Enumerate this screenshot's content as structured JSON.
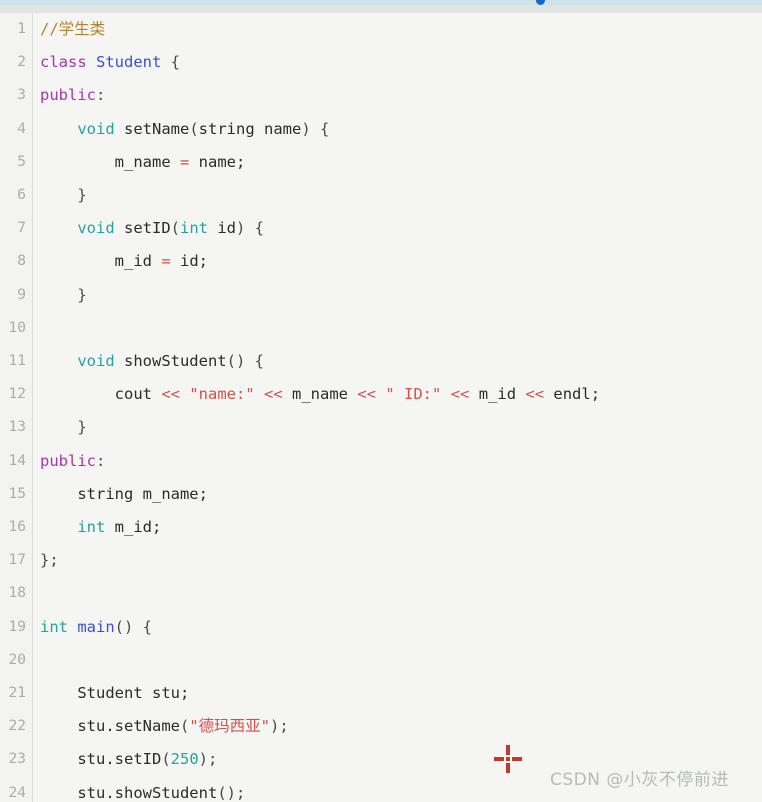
{
  "window": {
    "top_strip_color": "#cfe3ea",
    "header_band_color": "#e2e4e2",
    "accent_dot_color": "#1668c8",
    "editor_background": "#f5f6f4",
    "gutter_background": "#f3f4f2",
    "gutter_divider_color": "#dcdedc"
  },
  "palette": {
    "plain": "#2b2b2b",
    "comment": "#b5822e",
    "keyword": "#a535ae",
    "type": "#25a1a1",
    "class_name": "#3b4ddb",
    "function_name": "#3b4ddb",
    "string": "#d4504a",
    "operator": "#d4504a",
    "number": "#25a1a1",
    "line_number": "#a9acab"
  },
  "editor": {
    "language": "C++",
    "first_visible_line": 1,
    "last_visible_line": 24,
    "gutter_numbers": [
      "1",
      "2",
      "3",
      "4",
      "5",
      "6",
      "7",
      "8",
      "9",
      "10",
      "11",
      "12",
      "13",
      "14",
      "15",
      "16",
      "17",
      "18",
      "19",
      "20",
      "21",
      "22",
      "23",
      "24"
    ],
    "lines": [
      {
        "number": "1",
        "text": "//学生类"
      },
      {
        "number": "2",
        "text": "class Student {"
      },
      {
        "number": "3",
        "text": "public:"
      },
      {
        "number": "4",
        "text": "    void setName(string name) {"
      },
      {
        "number": "5",
        "text": "        m_name = name;"
      },
      {
        "number": "6",
        "text": "    }"
      },
      {
        "number": "7",
        "text": "    void setID(int id) {"
      },
      {
        "number": "8",
        "text": "        m_id = id;"
      },
      {
        "number": "9",
        "text": "    }"
      },
      {
        "number": "10",
        "text": ""
      },
      {
        "number": "11",
        "text": "    void showStudent() {"
      },
      {
        "number": "12",
        "text": "        cout << \"name:\" << m_name << \" ID:\" << m_id << endl;"
      },
      {
        "number": "13",
        "text": "    }"
      },
      {
        "number": "14",
        "text": "public:"
      },
      {
        "number": "15",
        "text": "    string m_name;"
      },
      {
        "number": "16",
        "text": "    int m_id;"
      },
      {
        "number": "17",
        "text": "};"
      },
      {
        "number": "18",
        "text": ""
      },
      {
        "number": "19",
        "text": "int main() {"
      },
      {
        "number": "20",
        "text": ""
      },
      {
        "number": "21",
        "text": "    Student stu;"
      },
      {
        "number": "22",
        "text": "    stu.setName(\"德玛西亚\");"
      },
      {
        "number": "23",
        "text": "    stu.setID(250);"
      },
      {
        "number": "24",
        "text": "    stu.showStudent();"
      }
    ],
    "tokens": [
      [
        {
          "t": "//学生类",
          "c": "comment"
        }
      ],
      [
        {
          "t": "class",
          "c": "keyword"
        },
        {
          "t": " ",
          "c": "plain"
        },
        {
          "t": "Student",
          "c": "class"
        },
        {
          "t": " {",
          "c": "punct"
        }
      ],
      [
        {
          "t": "public",
          "c": "keyword"
        },
        {
          "t": ":",
          "c": "punct"
        }
      ],
      [
        {
          "t": "    ",
          "c": "plain"
        },
        {
          "t": "void",
          "c": "type"
        },
        {
          "t": " setName",
          "c": "plain"
        },
        {
          "t": "(",
          "c": "punct"
        },
        {
          "t": "string",
          "c": "plain"
        },
        {
          "t": " name",
          "c": "plain"
        },
        {
          "t": ") {",
          "c": "punct"
        }
      ],
      [
        {
          "t": "        m_name ",
          "c": "plain"
        },
        {
          "t": "=",
          "c": "op"
        },
        {
          "t": " name;",
          "c": "plain"
        }
      ],
      [
        {
          "t": "    }",
          "c": "punct"
        }
      ],
      [
        {
          "t": "    ",
          "c": "plain"
        },
        {
          "t": "void",
          "c": "type"
        },
        {
          "t": " setID",
          "c": "plain"
        },
        {
          "t": "(",
          "c": "punct"
        },
        {
          "t": "int",
          "c": "type"
        },
        {
          "t": " id",
          "c": "plain"
        },
        {
          "t": ") {",
          "c": "punct"
        }
      ],
      [
        {
          "t": "        m_id ",
          "c": "plain"
        },
        {
          "t": "=",
          "c": "op"
        },
        {
          "t": " id;",
          "c": "plain"
        }
      ],
      [
        {
          "t": "    }",
          "c": "punct"
        }
      ],
      [],
      [
        {
          "t": "    ",
          "c": "plain"
        },
        {
          "t": "void",
          "c": "type"
        },
        {
          "t": " showStudent",
          "c": "plain"
        },
        {
          "t": "() {",
          "c": "punct"
        }
      ],
      [
        {
          "t": "        cout ",
          "c": "plain"
        },
        {
          "t": "<<",
          "c": "op"
        },
        {
          "t": " ",
          "c": "plain"
        },
        {
          "t": "\"name:\"",
          "c": "string"
        },
        {
          "t": " ",
          "c": "plain"
        },
        {
          "t": "<<",
          "c": "op"
        },
        {
          "t": " m_name ",
          "c": "plain"
        },
        {
          "t": "<<",
          "c": "op"
        },
        {
          "t": " ",
          "c": "plain"
        },
        {
          "t": "\" ID:\"",
          "c": "string"
        },
        {
          "t": " ",
          "c": "plain"
        },
        {
          "t": "<<",
          "c": "op"
        },
        {
          "t": " m_id ",
          "c": "plain"
        },
        {
          "t": "<<",
          "c": "op"
        },
        {
          "t": " endl;",
          "c": "plain"
        }
      ],
      [
        {
          "t": "    }",
          "c": "punct"
        }
      ],
      [
        {
          "t": "public",
          "c": "keyword"
        },
        {
          "t": ":",
          "c": "punct"
        }
      ],
      [
        {
          "t": "    string m_name;",
          "c": "plain"
        }
      ],
      [
        {
          "t": "    ",
          "c": "plain"
        },
        {
          "t": "int",
          "c": "type"
        },
        {
          "t": " m_id;",
          "c": "plain"
        }
      ],
      [
        {
          "t": "};",
          "c": "punct"
        }
      ],
      [],
      [
        {
          "t": "int",
          "c": "type"
        },
        {
          "t": " ",
          "c": "plain"
        },
        {
          "t": "main",
          "c": "func"
        },
        {
          "t": "() {",
          "c": "punct"
        }
      ],
      [],
      [
        {
          "t": "    Student stu;",
          "c": "plain"
        }
      ],
      [
        {
          "t": "    stu.setName",
          "c": "plain"
        },
        {
          "t": "(",
          "c": "punct"
        },
        {
          "t": "\"德玛西亚\"",
          "c": "string"
        },
        {
          "t": ");",
          "c": "punct"
        }
      ],
      [
        {
          "t": "    stu.setID",
          "c": "plain"
        },
        {
          "t": "(",
          "c": "punct"
        },
        {
          "t": "250",
          "c": "number"
        },
        {
          "t": ");",
          "c": "punct"
        }
      ],
      [
        {
          "t": "    stu.showStudent",
          "c": "plain"
        },
        {
          "t": "();",
          "c": "punct"
        }
      ]
    ]
  },
  "overlay": {
    "crosshair_color": "#c0392b",
    "watermark_text": "CSDN @小灰不停前进",
    "watermark_color": "#b6bab9"
  }
}
